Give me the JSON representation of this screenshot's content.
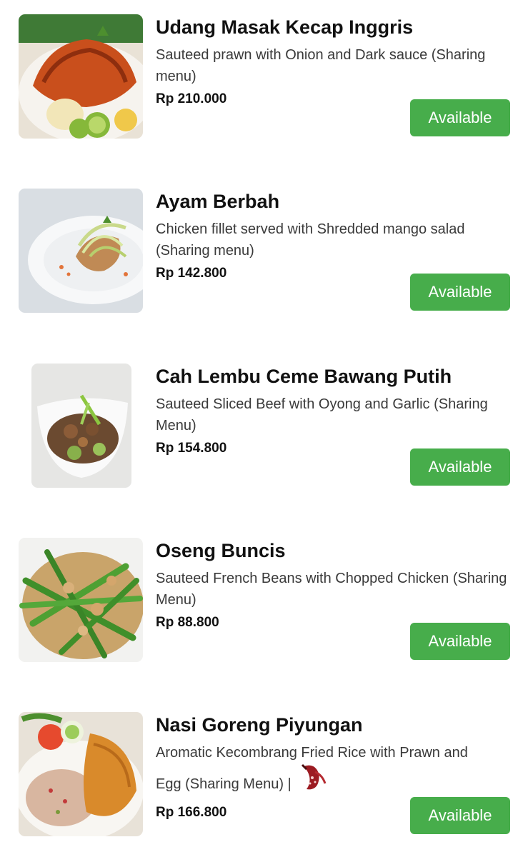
{
  "menu": {
    "items": [
      {
        "title": "Udang Masak Kecap Inggris",
        "description": "Sauteed prawn with Onion and Dark sauce (Sharing menu)",
        "price": "Rp 210.000",
        "status": "Available",
        "image": "prawn-dish-photo"
      },
      {
        "title": "Ayam Berbah",
        "description": "Chicken fillet served with Shredded mango salad (Sharing menu)",
        "price": "Rp 142.800",
        "status": "Available",
        "image": "chicken-fillet-photo"
      },
      {
        "title": "Cah Lembu Ceme Bawang Putih",
        "description": "Sauteed Sliced Beef with Oyong and Garlic (Sharing Menu)",
        "price": "Rp 154.800",
        "status": "Available",
        "image": "beef-stirfry-photo"
      },
      {
        "title": "Oseng Buncis",
        "description": "Sauteed French Beans with Chopped Chicken (Sharing Menu)",
        "price": "Rp 88.800",
        "status": "Available",
        "image": "french-beans-photo"
      },
      {
        "title": "Nasi Goreng Piyungan",
        "description_line1": "Aromatic Kecombrang Fried Rice with Prawn and",
        "description_line2": "Egg (Sharing Menu) |",
        "price": "Rp 166.800",
        "status": "Available",
        "image": "fried-rice-photo",
        "badge_icon": "chili-icon"
      }
    ]
  },
  "colors": {
    "available_button": "#47ad4b",
    "title_text": "#111111",
    "description_text": "#3a3a3a"
  }
}
